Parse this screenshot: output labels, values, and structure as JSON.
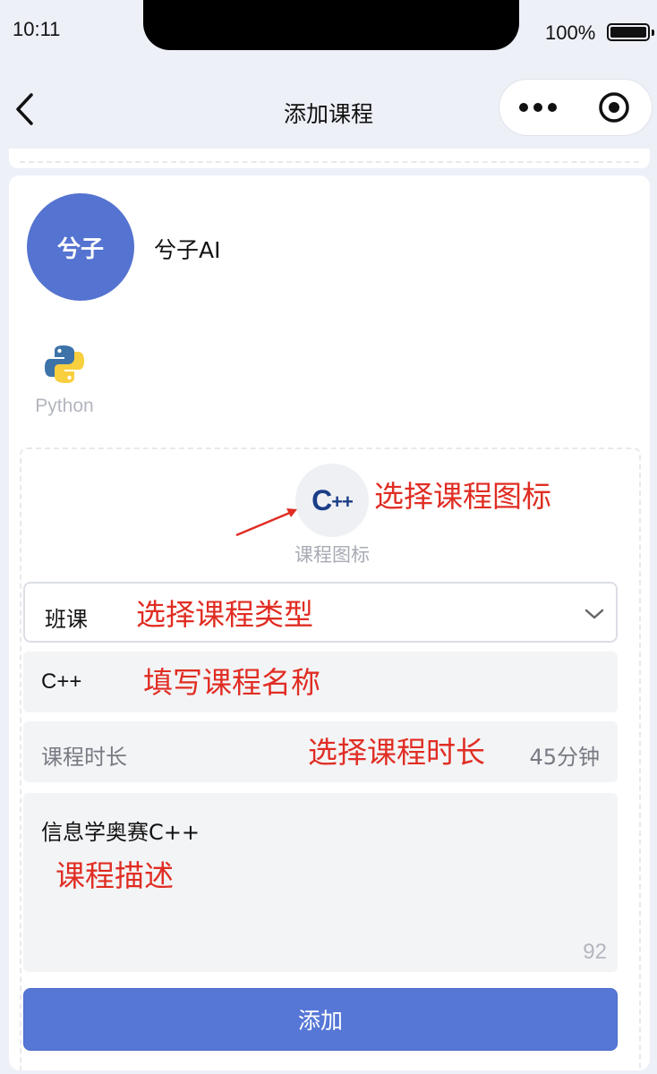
{
  "status_bar": {
    "time": "10:11",
    "battery": "100%"
  },
  "nav": {
    "back_icon": "chevron-left-icon",
    "title": "添加课程",
    "more_icon": "more-dots-icon",
    "close_icon": "target-circle-icon"
  },
  "profile": {
    "avatar_text": "兮子",
    "name": "兮子AI",
    "avatar_color": "#5573d0"
  },
  "course_list": [
    {
      "icon": "python-logo-icon",
      "label": "Python"
    }
  ],
  "form": {
    "course_icon": {
      "icon": "cpp-logo-icon",
      "glyph": "C",
      "glyph_suffix": "++",
      "label": "课程图标"
    },
    "type_select": {
      "value": "班课",
      "icon": "chevron-down-icon"
    },
    "name_input": {
      "value": "C++"
    },
    "duration": {
      "label": "课程时长",
      "value": "45分钟"
    },
    "description": {
      "value": "信息学奥赛C++",
      "char_count": "92"
    },
    "submit_label": "添加"
  },
  "annotations": {
    "icon_hint": "选择课程图标",
    "type_hint": "选择课程类型",
    "name_hint": "填写课程名称",
    "duration_hint": "选择课程时长",
    "desc_hint": "课程描述"
  },
  "colors": {
    "primary": "#5677d6",
    "annotation": "#e02d23",
    "background": "#eef0f8"
  }
}
